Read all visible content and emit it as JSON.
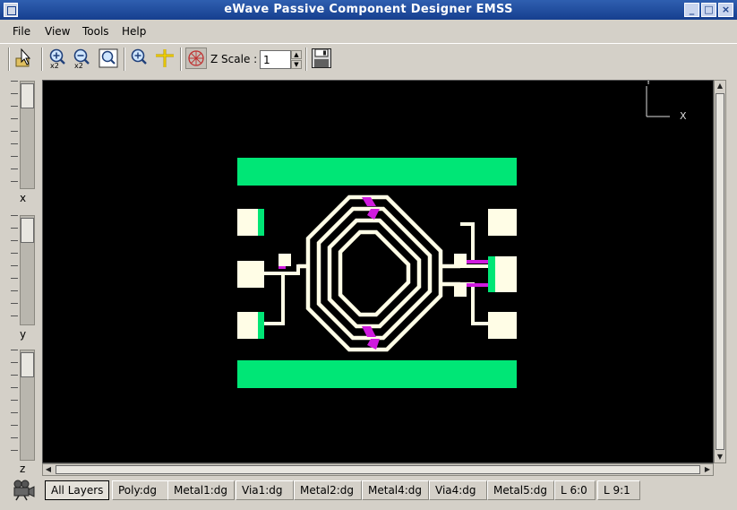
{
  "window": {
    "title": "eWave Passive Component Designer EMSS"
  },
  "menu": [
    "File",
    "View",
    "Tools",
    "Help"
  ],
  "toolbar": {
    "zscale_label": "Z Scale :",
    "zscale_value": "1",
    "zoom_in_badge": "x2",
    "zoom_out_badge": "x2"
  },
  "sliders": {
    "x_label": "x",
    "y_label": "y",
    "z_label": "z"
  },
  "axis": {
    "x": "X",
    "y": "Y"
  },
  "layers": [
    "All Layers",
    "Poly:dg",
    "Metal1:dg",
    "Via1:dg",
    "Metal2:dg",
    "Metal4:dg",
    "Via4:dg",
    "Metal5:dg",
    "L 6:0",
    "L 9:1"
  ],
  "colors": {
    "canvas": "#000000",
    "metal_green": "#00e676",
    "trace": "#fffde6",
    "via_magenta": "#d01adf",
    "titlebar": "#1f4f9f"
  },
  "icons": {
    "select": "select-tool-icon",
    "zoom_in": "zoom-in-icon",
    "zoom_out": "zoom-out-icon",
    "zoom_fit": "zoom-fit-icon",
    "zoom": "magnifier-icon",
    "pan": "pan-tool-icon",
    "rotate": "rotate-3d-icon",
    "save": "save-icon",
    "camera": "camera-icon"
  }
}
